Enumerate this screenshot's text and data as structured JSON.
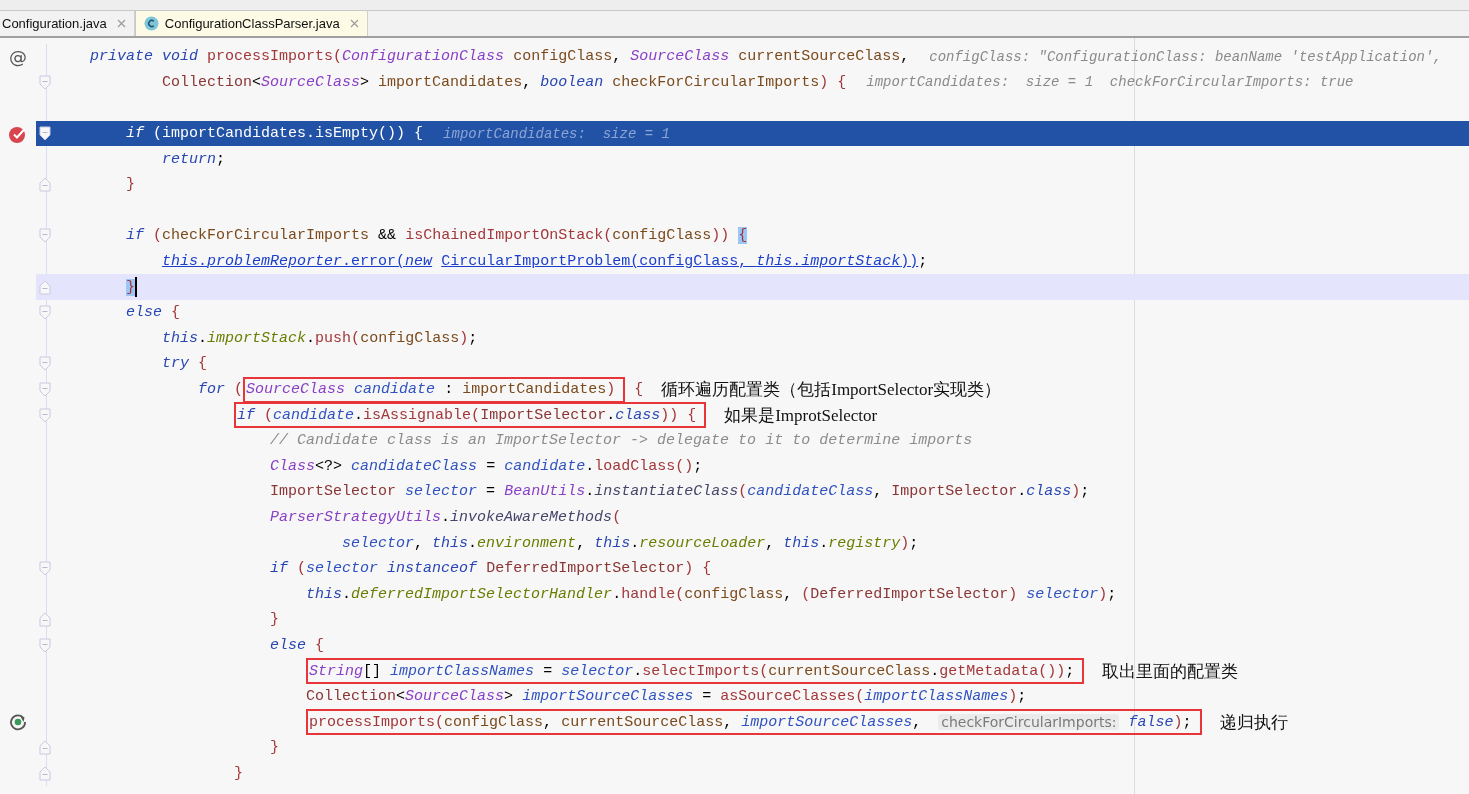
{
  "tabs": [
    {
      "label": "Configuration.java",
      "selected": false,
      "kind": "plain"
    },
    {
      "label": "ConfigurationClassParser.java",
      "selected": true,
      "kind": "java_class"
    }
  ],
  "lines": [
    {
      "gutter": {
        "kind": "glyph",
        "text": "@"
      },
      "segments": [
        {
          "kind": "code",
          "tokens": [
            {
              "text": "    private void ",
              "kind": "kw"
            },
            {
              "text": "processImports(",
              "kind": "m"
            },
            {
              "text": "ConfigurationClass",
              "kind": "ty"
            },
            {
              "text": " configClass",
              "kind": "p"
            },
            {
              "text": ", ",
              "kind": "x"
            },
            {
              "text": "SourceClass",
              "kind": "ty"
            },
            {
              "text": " currentSourceClass",
              "kind": "p"
            },
            {
              "text": ",",
              "kind": "x"
            }
          ]
        },
        {
          "kind": "hint",
          "text": "configClass: \"ConfigurationClass: beanName 'testApplication',"
        }
      ]
    },
    {
      "fold": {
        "kind": "start"
      },
      "segments": [
        {
          "kind": "code",
          "tokens": [
            {
              "text": "            Collection",
              "kind": "cl"
            },
            {
              "text": "<",
              "kind": "x"
            },
            {
              "text": "SourceClass",
              "kind": "ty"
            },
            {
              "text": "> ",
              "kind": "x"
            },
            {
              "text": "importCandidates",
              "kind": "p"
            },
            {
              "text": ", ",
              "kind": "x"
            },
            {
              "text": "boolean ",
              "kind": "kw"
            },
            {
              "text": "checkForCircularImports",
              "kind": "p"
            },
            {
              "text": ") {",
              "kind": "m"
            }
          ]
        },
        {
          "kind": "hint",
          "text": "importCandidates:  size = 1  checkForCircularImports: true"
        }
      ]
    },
    {
      "blank_line_before": true,
      "highlight": {
        "kind": "current"
      },
      "gutter": {
        "kind": "breakpoint"
      },
      "fold": {
        "kind": "start"
      },
      "segments": [
        {
          "kind": "code",
          "tokens": [
            {
              "text": "        if ",
              "kind": "kw"
            },
            {
              "text": "(importCandidates.isEmpty()) {",
              "kind": "x"
            }
          ]
        },
        {
          "kind": "hint",
          "text": "importCandidates:  size = 1"
        }
      ]
    },
    {
      "segments": [
        {
          "kind": "code",
          "tokens": [
            {
              "text": "            return",
              "kind": "kw"
            },
            {
              "text": ";",
              "kind": "x"
            }
          ]
        }
      ]
    },
    {
      "fold": {
        "kind": "end"
      },
      "segments": [
        {
          "kind": "code",
          "tokens": [
            {
              "text": "        }",
              "kind": "m"
            }
          ]
        }
      ]
    },
    {
      "blank_line_before": true,
      "fold": {
        "kind": "start"
      },
      "segments": [
        {
          "kind": "code",
          "tokens": [
            {
              "text": "        if ",
              "kind": "kw"
            },
            {
              "text": "(",
              "kind": "m"
            },
            {
              "text": "checkForCircularImports",
              "kind": "p"
            },
            {
              "text": " && ",
              "kind": "x"
            },
            {
              "text": "isChainedImportOnStack(",
              "kind": "m"
            },
            {
              "text": "configClass",
              "kind": "p"
            },
            {
              "text": ")) ",
              "kind": "m"
            },
            {
              "text": "{",
              "kind": "b"
            }
          ]
        }
      ]
    },
    {
      "segments": [
        {
          "kind": "code",
          "tokens": [
            {
              "text": "            this",
              "kind": "ui"
            },
            {
              "text": ".",
              "kind": "u"
            },
            {
              "text": "problemReporter",
              "kind": "ui"
            },
            {
              "text": ".error(",
              "kind": "u"
            },
            {
              "text": "new",
              "kind": "ui"
            },
            {
              "text": " CircularImportProblem(configClass, ",
              "kind": "u"
            },
            {
              "text": "this",
              "kind": "ui"
            },
            {
              "text": ".",
              "kind": "u"
            },
            {
              "text": "importStack",
              "kind": "ui"
            },
            {
              "text": "))",
              "kind": "u"
            },
            {
              "text": ";",
              "kind": "x"
            }
          ]
        }
      ]
    },
    {
      "highlight": {
        "kind": "caret"
      },
      "fold": {
        "kind": "end"
      },
      "segments": [
        {
          "kind": "code",
          "tokens": [
            {
              "text": "        }",
              "kind": "b"
            }
          ]
        }
      ]
    },
    {
      "fold": {
        "kind": "start"
      },
      "segments": [
        {
          "kind": "code",
          "tokens": [
            {
              "text": "        else ",
              "kind": "kw"
            },
            {
              "text": "{",
              "kind": "m"
            }
          ]
        }
      ]
    },
    {
      "segments": [
        {
          "kind": "code",
          "tokens": [
            {
              "text": "            this",
              "kind": "kw"
            },
            {
              "text": ".",
              "kind": "x"
            },
            {
              "text": "importStack",
              "kind": "f"
            },
            {
              "text": ".",
              "kind": "x"
            },
            {
              "text": "push(",
              "kind": "m"
            },
            {
              "text": "configClass",
              "kind": "p"
            },
            {
              "text": ")",
              "kind": "m"
            },
            {
              "text": ";",
              "kind": "x"
            }
          ]
        }
      ]
    },
    {
      "fold": {
        "kind": "start"
      },
      "segments": [
        {
          "kind": "code",
          "tokens": [
            {
              "text": "            try ",
              "kind": "kw"
            },
            {
              "text": "{",
              "kind": "m"
            }
          ]
        }
      ]
    },
    {
      "fold": {
        "kind": "start"
      },
      "segments": [
        {
          "kind": "code",
          "tokens": [
            {
              "text": "                for ",
              "kind": "kw"
            },
            {
              "text": "(",
              "kind": "m"
            }
          ]
        },
        {
          "kind": "boxed",
          "parts": [
            {
              "kind": "code",
              "tokens": [
                {
                  "text": "SourceClass ",
                  "kind": "ty"
                },
                {
                  "text": "candidate",
                  "kind": "l"
                },
                {
                  "text": " : ",
                  "kind": "x"
                },
                {
                  "text": "importCandidates",
                  "kind": "p"
                },
                {
                  "text": ")",
                  "kind": "m"
                }
              ]
            }
          ]
        },
        {
          "kind": "code",
          "tokens": [
            {
              "text": " {",
              "kind": "m"
            }
          ]
        },
        {
          "kind": "note",
          "text": "循环遍历配置类（包括ImportSelector实现类）"
        }
      ]
    },
    {
      "fold": {
        "kind": "start"
      },
      "segments": [
        {
          "kind": "boxed",
          "parts": [
            {
              "kind": "code",
              "tokens": [
                {
                  "text": "                    if ",
                  "kind": "kw"
                },
                {
                  "text": "(",
                  "kind": "m"
                },
                {
                  "text": "candidate",
                  "kind": "l"
                },
                {
                  "text": ".",
                  "kind": "x"
                },
                {
                  "text": "isAssignable(",
                  "kind": "m"
                },
                {
                  "text": "ImportSelector",
                  "kind": "cl"
                },
                {
                  "text": ".",
                  "kind": "x"
                },
                {
                  "text": "class",
                  "kind": "kw"
                },
                {
                  "text": ")) {",
                  "kind": "m"
                }
              ]
            }
          ]
        },
        {
          "kind": "note",
          "text": "如果是ImprotSelector"
        }
      ]
    },
    {
      "segments": [
        {
          "kind": "code",
          "tokens": [
            {
              "text": "                        // Candidate class is an ImportSelector -> delegate to it to determine imports",
              "kind": "c"
            }
          ]
        }
      ]
    },
    {
      "segments": [
        {
          "kind": "code",
          "tokens": [
            {
              "text": "                        Class",
              "kind": "ty"
            },
            {
              "text": "<?> ",
              "kind": "x"
            },
            {
              "text": "candidateClass",
              "kind": "l"
            },
            {
              "text": " = ",
              "kind": "x"
            },
            {
              "text": "candidate",
              "kind": "l"
            },
            {
              "text": ".",
              "kind": "x"
            },
            {
              "text": "loadClass()",
              "kind": "m"
            },
            {
              "text": ";",
              "kind": "x"
            }
          ]
        }
      ]
    },
    {
      "segments": [
        {
          "kind": "code",
          "tokens": [
            {
              "text": "                        ImportSelector ",
              "kind": "cl"
            },
            {
              "text": "selector",
              "kind": "l"
            },
            {
              "text": " = ",
              "kind": "x"
            },
            {
              "text": "BeanUtils",
              "kind": "ty"
            },
            {
              "text": ".",
              "kind": "x"
            },
            {
              "text": "instantiateClass",
              "kind": "s"
            },
            {
              "text": "(",
              "kind": "m"
            },
            {
              "text": "candidateClass",
              "kind": "l"
            },
            {
              "text": ", ",
              "kind": "x"
            },
            {
              "text": "ImportSelector",
              "kind": "cl"
            },
            {
              "text": ".",
              "kind": "x"
            },
            {
              "text": "class",
              "kind": "kw"
            },
            {
              "text": ")",
              "kind": "m"
            },
            {
              "text": ";",
              "kind": "x"
            }
          ]
        }
      ]
    },
    {
      "segments": [
        {
          "kind": "code",
          "tokens": [
            {
              "text": "                        ParserStrategyUtils",
              "kind": "ty"
            },
            {
              "text": ".",
              "kind": "x"
            },
            {
              "text": "invokeAwareMethods",
              "kind": "s"
            },
            {
              "text": "(",
              "kind": "m"
            }
          ]
        }
      ]
    },
    {
      "segments": [
        {
          "kind": "code",
          "tokens": [
            {
              "text": "                                selector",
              "kind": "l"
            },
            {
              "text": ", ",
              "kind": "x"
            },
            {
              "text": "this",
              "kind": "kw"
            },
            {
              "text": ".",
              "kind": "x"
            },
            {
              "text": "environment",
              "kind": "f"
            },
            {
              "text": ", ",
              "kind": "x"
            },
            {
              "text": "this",
              "kind": "kw"
            },
            {
              "text": ".",
              "kind": "x"
            },
            {
              "text": "resourceLoader",
              "kind": "f"
            },
            {
              "text": ", ",
              "kind": "x"
            },
            {
              "text": "this",
              "kind": "kw"
            },
            {
              "text": ".",
              "kind": "x"
            },
            {
              "text": "registry",
              "kind": "f"
            },
            {
              "text": ")",
              "kind": "m"
            },
            {
              "text": ";",
              "kind": "x"
            }
          ]
        }
      ]
    },
    {
      "fold": {
        "kind": "start"
      },
      "segments": [
        {
          "kind": "code",
          "tokens": [
            {
              "text": "                        if ",
              "kind": "kw"
            },
            {
              "text": "(",
              "kind": "m"
            },
            {
              "text": "selector",
              "kind": "l"
            },
            {
              "text": " instanceof ",
              "kind": "kw"
            },
            {
              "text": "DeferredImportSelector",
              "kind": "cl"
            },
            {
              "text": ") {",
              "kind": "m"
            }
          ]
        }
      ]
    },
    {
      "segments": [
        {
          "kind": "code",
          "tokens": [
            {
              "text": "                            this",
              "kind": "kw"
            },
            {
              "text": ".",
              "kind": "x"
            },
            {
              "text": "deferredImportSelectorHandler",
              "kind": "f"
            },
            {
              "text": ".",
              "kind": "x"
            },
            {
              "text": "handle(",
              "kind": "m"
            },
            {
              "text": "configClass",
              "kind": "p"
            },
            {
              "text": ", ",
              "kind": "x"
            },
            {
              "text": "(",
              "kind": "m"
            },
            {
              "text": "DeferredImportSelector",
              "kind": "cl"
            },
            {
              "text": ") ",
              "kind": "m"
            },
            {
              "text": "selector",
              "kind": "l"
            },
            {
              "text": ")",
              "kind": "m"
            },
            {
              "text": ";",
              "kind": "x"
            }
          ]
        }
      ]
    },
    {
      "fold": {
        "kind": "end"
      },
      "segments": [
        {
          "kind": "code",
          "tokens": [
            {
              "text": "                        }",
              "kind": "m"
            }
          ]
        }
      ]
    },
    {
      "fold": {
        "kind": "start"
      },
      "segments": [
        {
          "kind": "code",
          "tokens": [
            {
              "text": "                        else ",
              "kind": "kw"
            },
            {
              "text": "{",
              "kind": "m"
            }
          ]
        }
      ]
    },
    {
      "segments": [
        {
          "kind": "boxed",
          "parts": [
            {
              "kind": "code",
              "tokens": [
                {
                  "text": "                            String",
                  "kind": "ty"
                },
                {
                  "text": "[] ",
                  "kind": "x"
                },
                {
                  "text": "importClassNames",
                  "kind": "l"
                },
                {
                  "text": " = ",
                  "kind": "x"
                },
                {
                  "text": "selector",
                  "kind": "l"
                },
                {
                  "text": ".",
                  "kind": "x"
                },
                {
                  "text": "selectImports(",
                  "kind": "m"
                },
                {
                  "text": "currentSourceClass",
                  "kind": "p"
                },
                {
                  "text": ".",
                  "kind": "x"
                },
                {
                  "text": "getMetadata())",
                  "kind": "m"
                },
                {
                  "text": ";",
                  "kind": "x"
                }
              ]
            }
          ]
        },
        {
          "kind": "note",
          "text": "取出里面的配置类"
        }
      ]
    },
    {
      "segments": [
        {
          "kind": "code",
          "tokens": [
            {
              "text": "                            Collection",
              "kind": "cl"
            },
            {
              "text": "<",
              "kind": "x"
            },
            {
              "text": "SourceClass",
              "kind": "ty"
            },
            {
              "text": "> ",
              "kind": "x"
            },
            {
              "text": "importSourceClasses",
              "kind": "l"
            },
            {
              "text": " = ",
              "kind": "x"
            },
            {
              "text": "asSourceClasses(",
              "kind": "m"
            },
            {
              "text": "importClassNames",
              "kind": "l"
            },
            {
              "text": ")",
              "kind": "m"
            },
            {
              "text": ";",
              "kind": "x"
            }
          ]
        }
      ]
    },
    {
      "gutter": {
        "kind": "recursion"
      },
      "segments": [
        {
          "kind": "boxed",
          "parts": [
            {
              "kind": "code",
              "tokens": [
                {
                  "text": "                            processImports(",
                  "kind": "m"
                },
                {
                  "text": "configClass",
                  "kind": "p"
                },
                {
                  "text": ", ",
                  "kind": "x"
                },
                {
                  "text": "currentSourceClass",
                  "kind": "p"
                },
                {
                  "text": ", ",
                  "kind": "x"
                },
                {
                  "text": "importSourceClasses",
                  "kind": "l"
                },
                {
                  "text": ", ",
                  "kind": "x"
                }
              ]
            },
            {
              "kind": "param_hint",
              "text": "checkForCircularImports:"
            },
            {
              "kind": "code",
              "tokens": [
                {
                  "text": " false",
                  "kind": "kw"
                },
                {
                  "text": ")",
                  "kind": "m"
                },
                {
                  "text": ";",
                  "kind": "x"
                }
              ]
            }
          ]
        },
        {
          "kind": "note",
          "text": "递归执行"
        }
      ]
    },
    {
      "fold": {
        "kind": "end"
      },
      "segments": [
        {
          "kind": "code",
          "tokens": [
            {
              "text": "                        }",
              "kind": "m"
            }
          ]
        }
      ]
    },
    {
      "fold": {
        "kind": "end"
      },
      "segments": [
        {
          "kind": "code",
          "tokens": [
            {
              "text": "                    }",
              "kind": "m"
            }
          ]
        }
      ]
    }
  ]
}
